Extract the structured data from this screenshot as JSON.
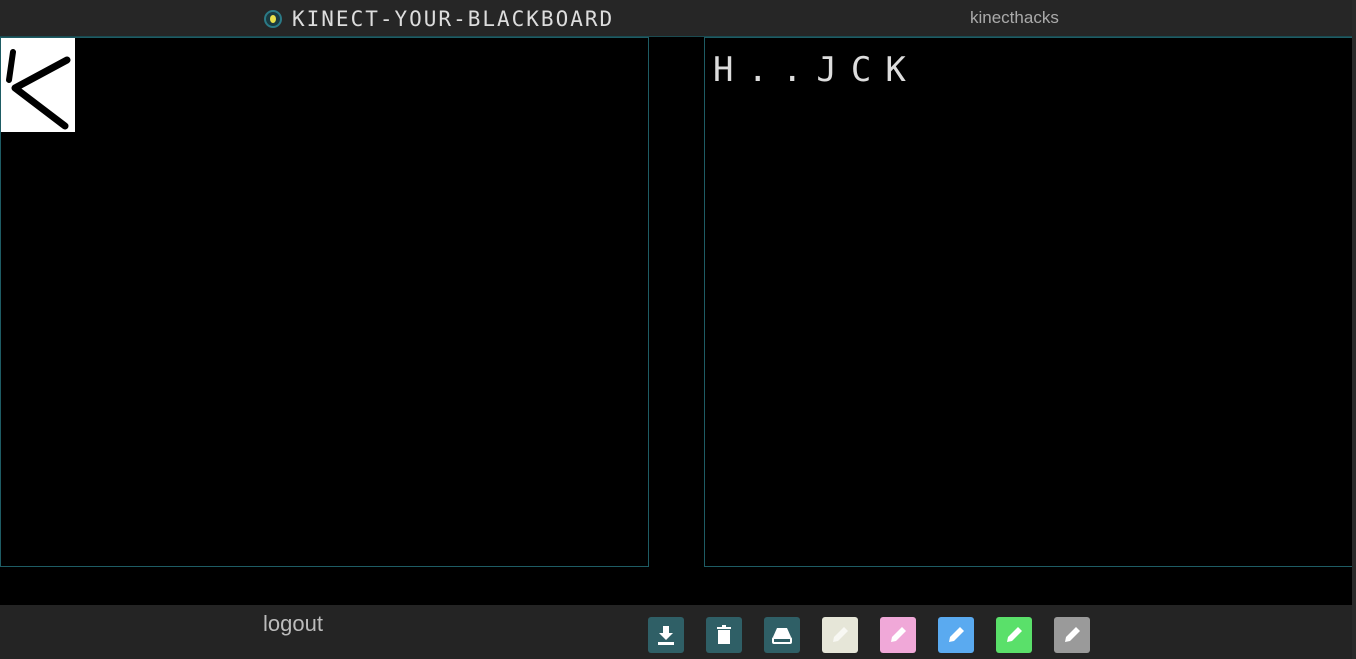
{
  "header": {
    "title": "KINECT-YOUR-BLACKBOARD",
    "username": "kinecthacks"
  },
  "canvas": {
    "recognized_text": "H..JCK"
  },
  "footer": {
    "logout_label": "logout"
  },
  "toolbar": [
    {
      "name": "download",
      "icon": "download-icon",
      "color": "#2f5f66"
    },
    {
      "name": "clear",
      "icon": "trash-icon",
      "color": "#2f5f66"
    },
    {
      "name": "save",
      "icon": "drive-icon",
      "color": "#2f5f66"
    },
    {
      "name": "pen-white",
      "icon": "pencil-icon",
      "color": "#e6e6d8"
    },
    {
      "name": "pen-pink",
      "icon": "pencil-icon",
      "color": "#f0a8d8"
    },
    {
      "name": "pen-blue",
      "icon": "pencil-icon",
      "color": "#5aaaf0"
    },
    {
      "name": "pen-green",
      "icon": "pencil-icon",
      "color": "#5ae06a"
    },
    {
      "name": "pen-gray",
      "icon": "pencil-icon",
      "color": "#9a9a9a"
    }
  ]
}
